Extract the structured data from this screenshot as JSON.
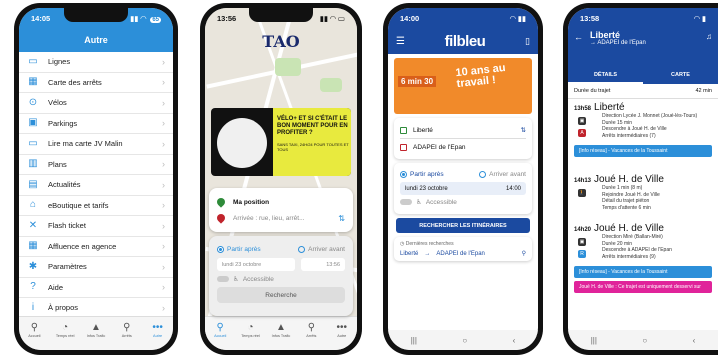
{
  "phone1": {
    "status_time": "14:05",
    "battery": "65",
    "title": "Autre",
    "menu": [
      {
        "label": "Lignes",
        "icon": "bus-line-icon",
        "glyph": "▭"
      },
      {
        "label": "Carte des arrêts",
        "icon": "map-icon",
        "glyph": "▦"
      },
      {
        "label": "Vélos",
        "icon": "bike-icon",
        "glyph": "⊙"
      },
      {
        "label": "Parkings",
        "icon": "car-icon",
        "glyph": "▣"
      },
      {
        "label": "Lire ma carte JV Malin",
        "icon": "card-icon",
        "glyph": "▭"
      },
      {
        "label": "Plans",
        "icon": "plans-icon",
        "glyph": "▥"
      },
      {
        "label": "Actualités",
        "icon": "news-icon",
        "glyph": "▤"
      },
      {
        "label": "eBoutique et tarifs",
        "icon": "shop-icon",
        "glyph": "⌂"
      },
      {
        "label": "Flash ticket",
        "icon": "ticket-icon",
        "glyph": "✕"
      },
      {
        "label": "Affluence en agence",
        "icon": "calendar-icon",
        "glyph": "▦"
      },
      {
        "label": "Paramètres",
        "icon": "gear-icon",
        "glyph": "✱"
      },
      {
        "label": "Aide",
        "icon": "help-icon",
        "glyph": "?"
      },
      {
        "label": "À propos",
        "icon": "info-icon",
        "glyph": "i"
      }
    ],
    "tabs": [
      {
        "label": "Accueil",
        "glyph": "⚲"
      },
      {
        "label": "Temps réel",
        "glyph": "◔"
      },
      {
        "label": "Infos Trafic",
        "glyph": "▲"
      },
      {
        "label": "Arrêts",
        "glyph": "⚲"
      },
      {
        "label": "Autre",
        "glyph": "•••"
      }
    ]
  },
  "phone2": {
    "status_time": "13:56",
    "logo": "TAO",
    "banner_title": "VÉLO+ ET SI C'ÉTAIT LE BON MOMENT POUR EN PROFITER ?",
    "banner_sub": "SANS TAXI, 24H/24 POUR TOUTES ET TOUS",
    "from": "Ma position",
    "to_placeholder": "Arrivée : rue, lieu, arrêt...",
    "depart_label": "Partir après",
    "arrive_label": "Arriver avant",
    "date": "lundi 23 octobre",
    "time": "13:56",
    "accessible": "Accessible",
    "search_btn": "Recherche",
    "tabs": [
      {
        "label": "Accueil",
        "glyph": "⚲"
      },
      {
        "label": "Temps réel",
        "glyph": "◔"
      },
      {
        "label": "Infos Trafic",
        "glyph": "▲"
      },
      {
        "label": "Arrêts",
        "glyph": "⚲"
      },
      {
        "label": "Autre",
        "glyph": "•••"
      }
    ]
  },
  "phone3": {
    "status_time": "14:00",
    "brand": "filbleu",
    "ad_text": "10 ans au travail !",
    "ad_left": "6 min 30",
    "from": "Liberté",
    "to": "ADAPEI de l'Epan",
    "depart_label": "Partir après",
    "arrive_label": "Arriver avant",
    "date": "lundi 23 octobre",
    "time": "14:00",
    "accessible": "Accessible",
    "search_btn": "RECHERCHER LES ITINÉRAIRES",
    "recent_title": "Dernières recherches",
    "recent_from": "Liberté",
    "recent_to": "ADAPEI de l'Epan"
  },
  "phone4": {
    "status_time": "13:58",
    "title": "Liberté",
    "subtitle": "→ ADAPEI de l'Epan",
    "tab_details": "DÉTAILS",
    "tab_map": "CARTE",
    "duration_label": "Durée du trajet",
    "duration": "42 min",
    "leg1_time": "13h58",
    "leg1_stop": "Liberté",
    "leg1_lines": [
      "Direction   Lycée J. Monnet (Joué-lès-Tours)",
      "Durée   15 min",
      "Descendre à Joué H. de Ville",
      "Arrêts intermédiaires (7)"
    ],
    "info1": "[Info réseau] - Vacances de la Toussaint",
    "leg2_time": "14h13",
    "leg2_stop": "Joué H. de Ville",
    "leg2_lines": [
      "Durée   1 min (8 m)",
      "Rejoindre Joué H. de Ville",
      "Détail du trajet piéton",
      "Temps d'attente 6 min"
    ],
    "leg3_time": "14h20",
    "leg3_stop": "Joué H. de Ville",
    "leg3_lines": [
      "Direction   Miré (Ballan-Miré)",
      "Durée   20 min",
      "Descendre à ADAPEI de l'Epan",
      "Arrêts intermédiaires (9)"
    ],
    "info2": "[Info réseau] - Vacances de la Toussaint",
    "info3": "Joué H. de Ville : Ce trajet est uniquement desservi sur"
  }
}
